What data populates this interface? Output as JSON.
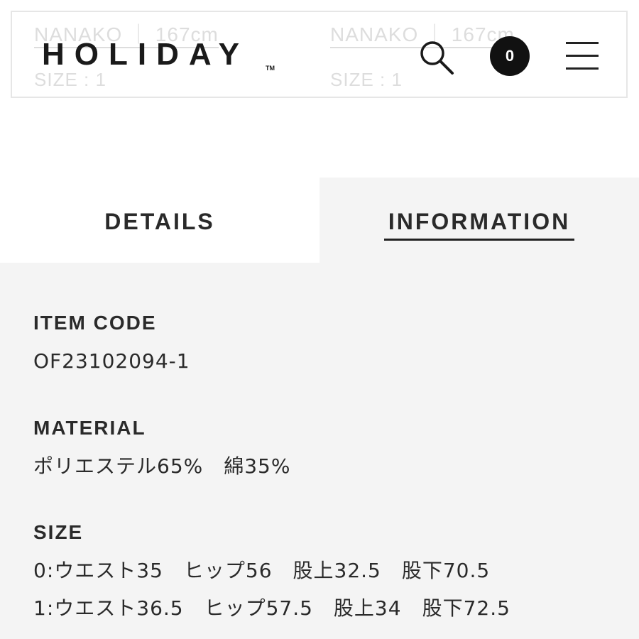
{
  "header": {
    "logo_text": "HOLIDAY",
    "logo_trademark": "TM",
    "cart_count": "0",
    "background_model_labels": [
      {
        "model": "NANAKO ｜ 167cm",
        "size": "SIZE : 1"
      },
      {
        "model": "NANAKO ｜ 167cm",
        "size": "SIZE : 1"
      }
    ],
    "icons": {
      "search": "search-icon",
      "cart": "cart-icon",
      "menu": "hamburger-menu-icon"
    }
  },
  "tabs": [
    {
      "label": "DETAILS",
      "active": false
    },
    {
      "label": "INFORMATION",
      "active": true
    }
  ],
  "information": {
    "item_code": {
      "heading": "ITEM CODE",
      "value": "OF23102094-1"
    },
    "material": {
      "heading": "MATERIAL",
      "value": "ポリエステル65%　綿35%"
    },
    "size": {
      "heading": "SIZE",
      "rows": [
        "0:ウエスト35　ヒップ56　股上32.5　股下70.5",
        "1:ウエスト36.5　ヒップ57.5　股上34　股下72.5"
      ]
    }
  },
  "colors": {
    "text": "#222222",
    "panel_background": "#f4f4f4",
    "header_border": "#e6e6e6",
    "cart_badge": "#111111"
  }
}
